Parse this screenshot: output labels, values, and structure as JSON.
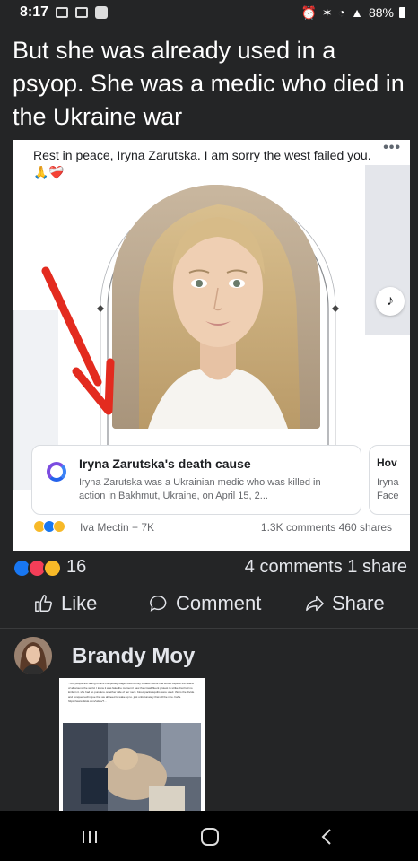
{
  "status_bar": {
    "time": "8:17",
    "battery": "88%"
  },
  "post": {
    "text": "But she was already used in a psyop. She was a medic who died in the Ukraine war"
  },
  "shared_post": {
    "caption": "Rest in peace, Iryna Zarutska. I am sorry the west failed you. 🙏❤️‍🩹",
    "link": {
      "title": "Iryna Zarutska's death cause",
      "description": "Iryna Zarutska was a Ukrainian medic who was killed in action in Bakhmut, Ukraine, on April 15, 2..."
    },
    "link2": {
      "title": "Hov",
      "description_line1": "Iryna",
      "description_line2": "Face"
    },
    "reactions_names": "Iva Mectin + 7K",
    "stats": "1.3K comments  460 shares"
  },
  "stats": {
    "reactions_count": "16",
    "comments_shares": "4 comments  1 share"
  },
  "actions": {
    "like": "Like",
    "comment": "Comment",
    "share": "Share"
  },
  "comment": {
    "author": "Brandy Moy",
    "screenshot_text": "...our people are falling for this completely staged event. they creates scene that would capture the hearts of all around the world. I know it was fake the moment I saw the crowd fluent protest to strike that had no knife in it. she had no puncture on either side of her neck. blood packs/squibs were used. this is the divide and conquer technique that we all need to wake up to. just unfortunately that will be rare. haha. https://www.tiktok.com/video/7..."
  },
  "colors": {
    "background": "#242526",
    "card": "#ffffff",
    "arrow": "#e32b1f",
    "like_blue": "#1877f2"
  }
}
